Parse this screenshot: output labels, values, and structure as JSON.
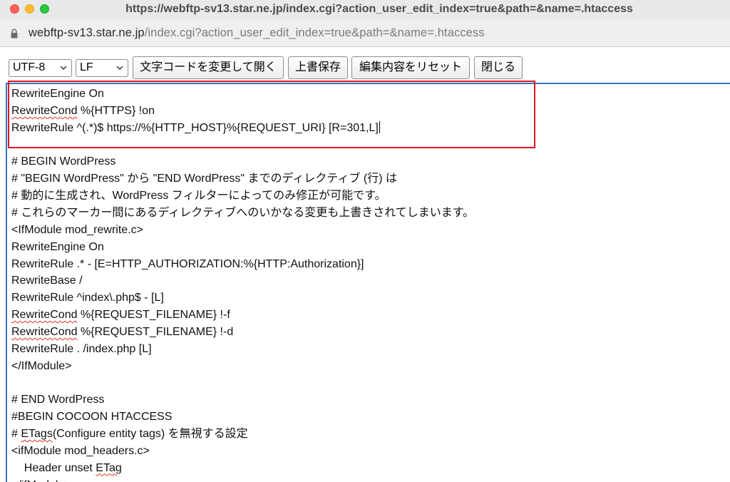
{
  "window": {
    "title": "https://webftp-sv13.star.ne.jp/index.cgi?action_user_edit_index=true&path=&name=.htaccess"
  },
  "address_bar": {
    "host": "webftp-sv13.star.ne.jp",
    "path": "/index.cgi?action_user_edit_index=true&path=&name=.htaccess",
    "icon": "lock-icon"
  },
  "toolbar": {
    "encoding_select": "UTF-8",
    "newline_select": "LF",
    "reopen_label": "文字コードを変更して開く",
    "save_label": "上書保存",
    "reset_label": "編集内容をリセット",
    "close_label": "閉じる"
  },
  "editor": {
    "highlight_color": "#e0141e",
    "lines": [
      [
        {
          "t": "RewriteEngine On"
        }
      ],
      [
        {
          "t": "RewriteCond",
          "sq": true
        },
        {
          "t": " %{HTTPS} !on"
        }
      ],
      [
        {
          "t": "RewriteRule ^(.*)$ https://%{HTTP_HOST}%{REQUEST_URI} [R=301,L]"
        }
      ],
      [],
      [
        {
          "t": "# BEGIN WordPress"
        }
      ],
      [
        {
          "t": "# \"BEGIN WordPress\" から \"END WordPress\" までのディレクティブ (行) は"
        }
      ],
      [
        {
          "t": "# 動的に生成され、WordPress フィルターによってのみ修正が可能です。"
        }
      ],
      [
        {
          "t": "# これらのマーカー間にあるディレクティブへのいかなる変更も上書きされてしまいます。"
        }
      ],
      [
        {
          "t": "<IfModule mod_rewrite.c>"
        }
      ],
      [
        {
          "t": "RewriteEngine On"
        }
      ],
      [
        {
          "t": "RewriteRule .* - [E=HTTP_AUTHORIZATION:%{HTTP:Authorization}]"
        }
      ],
      [
        {
          "t": "RewriteBase /"
        }
      ],
      [
        {
          "t": "RewriteRule ^index\\.php$ - [L]"
        }
      ],
      [
        {
          "t": "RewriteCond",
          "sq": true
        },
        {
          "t": " %{REQUEST_FILENAME} !-f"
        }
      ],
      [
        {
          "t": "RewriteCond",
          "sq": true
        },
        {
          "t": " %{REQUEST_FILENAME} !-d"
        }
      ],
      [
        {
          "t": "RewriteRule . /index.php [L]"
        }
      ],
      [
        {
          "t": "</IfModule>"
        }
      ],
      [],
      [
        {
          "t": "# END WordPress"
        }
      ],
      [
        {
          "t": "#BEGIN COCOON HTACCESS"
        }
      ],
      [
        {
          "t": "# "
        },
        {
          "t": "ETags",
          "sq": true
        },
        {
          "t": "(Configure entity tags) を無視する設定"
        }
      ],
      [
        {
          "t": "<ifModule mod_headers.c>"
        }
      ],
      [
        {
          "t": "    Header unset "
        },
        {
          "t": "ETag",
          "sq": true
        }
      ],
      [
        {
          "t": "</ifModule>"
        }
      ]
    ]
  }
}
